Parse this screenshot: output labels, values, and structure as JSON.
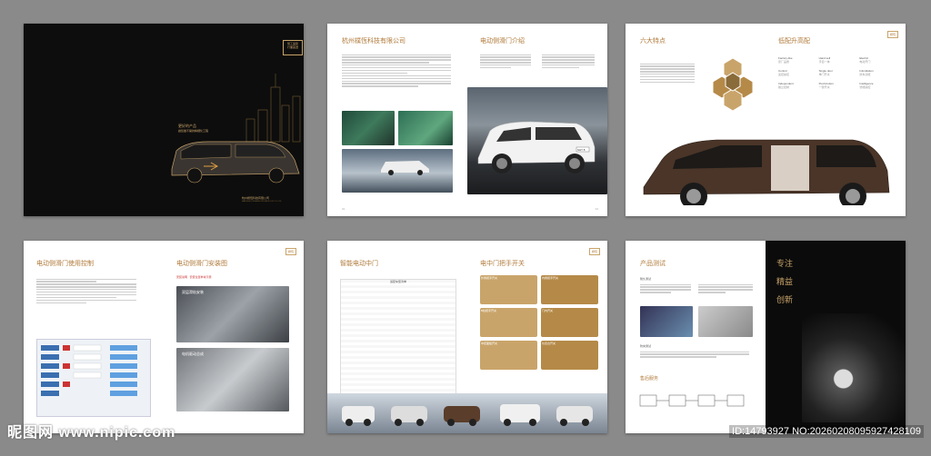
{
  "cover": {
    "badge": "施工遠建\n行業首選",
    "tagline_1": "更好的产品",
    "tagline_2": "讓您離不開的精細化工程",
    "company": "杭州樸恆科技有限公司",
    "company_en": "HANGZHOU PUHENG TECHNOLOGY CO.,LTD"
  },
  "p1": {
    "title": "杭州樸恆科技有限公司"
  },
  "p2": {
    "title": "电动侧滑门介绍",
    "plate": "SHT 8"
  },
  "p3": {
    "title": "六大特点"
  },
  "p4": {
    "title": "低配升高配",
    "logo": "樸恆",
    "features": [
      {
        "en": "Factory-like",
        "cn": "原厂品质"
      },
      {
        "en": "Hand sell",
        "cn": "手自一体"
      },
      {
        "en": "Electric",
        "cn": "电动开门"
      },
      {
        "en": "Control",
        "cn": "遥控操控"
      },
      {
        "en": "Single door",
        "cn": "单门开关"
      },
      {
        "en": "Intimidation",
        "cn": "防夹功能"
      },
      {
        "en": "Independent",
        "cn": "独立控制"
      },
      {
        "en": "Push-button",
        "cn": "一键开关"
      },
      {
        "en": "Intelligence",
        "cn": "智能操控"
      }
    ]
  },
  "p5": {
    "title": "电动侧滑门使用控制"
  },
  "p6": {
    "title": "电动侧滑门安装图",
    "red_note": "安装说明 · 安装位置参考示意",
    "label1": "双层滑轨安装",
    "label2": "电机驱动总成"
  },
  "p7": {
    "title": "智能电动中门",
    "table_title": "适配车型清单"
  },
  "p8": {
    "title": "电中门把手开关",
    "caps": [
      "外侧把手开关",
      "内侧把手开关",
      "B柱把手开关",
      "门内开关",
      "中控面板开关",
      "仪表台开关"
    ]
  },
  "p9": {
    "title": "产品测试",
    "sub1": "耐久测试",
    "sub2": "防夹测试",
    "sub3": "售后服务"
  },
  "p10": {
    "big1": "专注",
    "big2": "精益",
    "big3": "创新"
  },
  "watermark": {
    "left": "昵图网 www.nipic.com",
    "right": "ID:14793927 NO:20260208095927428109"
  }
}
